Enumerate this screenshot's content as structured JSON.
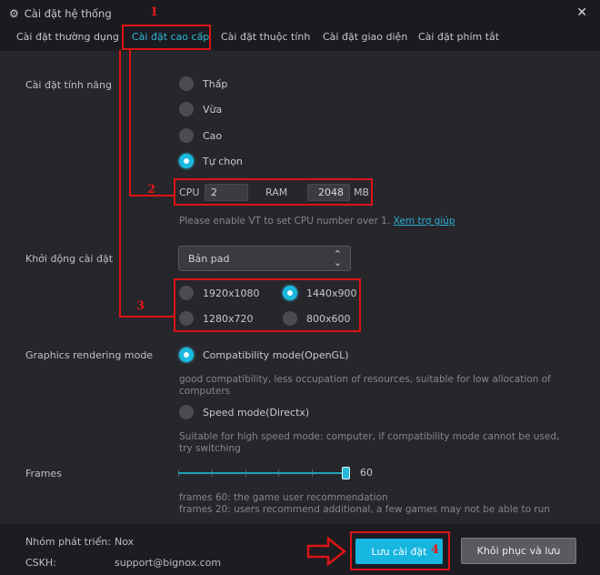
{
  "window": {
    "title": "Cài đặt hệ thống",
    "title_icon": "gear-icon",
    "close_icon": "close-icon"
  },
  "tabs": [
    {
      "label": "Cài đặt thường dụng",
      "active": false
    },
    {
      "label": "Cài đặt cao cấp",
      "active": true
    },
    {
      "label": "Cài đặt thuộc tính",
      "active": false
    },
    {
      "label": "Cài đặt giao diện",
      "active": false
    },
    {
      "label": "Cài đặt phím tắt",
      "active": false
    }
  ],
  "performance": {
    "label": "Cài đặt tính năng",
    "options": [
      {
        "label": "Thấp",
        "selected": false
      },
      {
        "label": "Vừa",
        "selected": false
      },
      {
        "label": "Cao",
        "selected": false
      },
      {
        "label": "Tự chọn",
        "selected": true
      }
    ],
    "cpu_label": "CPU",
    "cpu_value": "2",
    "ram_label": "RAM",
    "ram_value": "2048",
    "ram_unit": "MB",
    "hint": "Please enable VT to set CPU number over 1.",
    "help_link": "Xem trợ giúp"
  },
  "startup": {
    "label": "Khởi động cài đặt",
    "select_value": "Bản pad",
    "select_icon": "up-down-chevron-icon",
    "resolutions": [
      {
        "label": "1920x1080",
        "selected": false
      },
      {
        "label": "1440x900",
        "selected": true
      },
      {
        "label": "1280x720",
        "selected": false
      },
      {
        "label": "800x600",
        "selected": false
      }
    ]
  },
  "graphics": {
    "label": "Graphics rendering mode",
    "options": [
      {
        "label": "Compatibility mode(OpenGL)",
        "selected": true,
        "desc": "good compatibility, less occupation of resources, suitable for low allocation of computers"
      },
      {
        "label": "Speed mode(Directx)",
        "selected": false,
        "desc": "Suitable for high speed mode: computer, if compatibility mode cannot be used, try switching"
      }
    ]
  },
  "frames": {
    "label": "Frames",
    "value": "60",
    "fraction": 1.0,
    "ticks": 6,
    "hint_1": "frames 60: the game user recommendation",
    "hint_2": "frames 20: users recommend additional, a few games may not be able to run"
  },
  "footer": {
    "dev_label": "Nhóm phát triển:",
    "dev_value": "Nox",
    "support_label": "CSKH:",
    "support_value": "support@bignox.com",
    "save_label": "Lưu cài đặt",
    "restore_label": "Khôi phục và lưu"
  },
  "annotations": {
    "n1": "1",
    "n2": "2",
    "n3": "3",
    "n4": "4",
    "color": "#dc1414"
  },
  "colors": {
    "accent": "#19b9e0",
    "background": "#26262b",
    "titlebar": "#1b1b1f"
  }
}
